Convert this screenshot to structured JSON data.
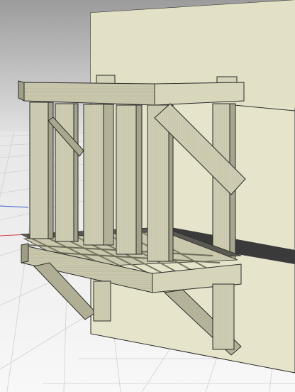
{
  "scene": {
    "colors": {
      "sky_top": "#9a9a9a",
      "sky_bottom": "#e6e6e6",
      "ground": "#f2f2f2",
      "grid_line": "#c7c7c7",
      "wall": "#e6e5cc",
      "wall_shadow": "#c9c8ac",
      "wood_light": "#cfceb3",
      "wood_mid": "#b9b89c",
      "wood_dark": "#8f8e76",
      "edge": "#2a2a2a",
      "axis_red": "#d23c3c",
      "axis_blue": "#3c5ad2"
    }
  }
}
